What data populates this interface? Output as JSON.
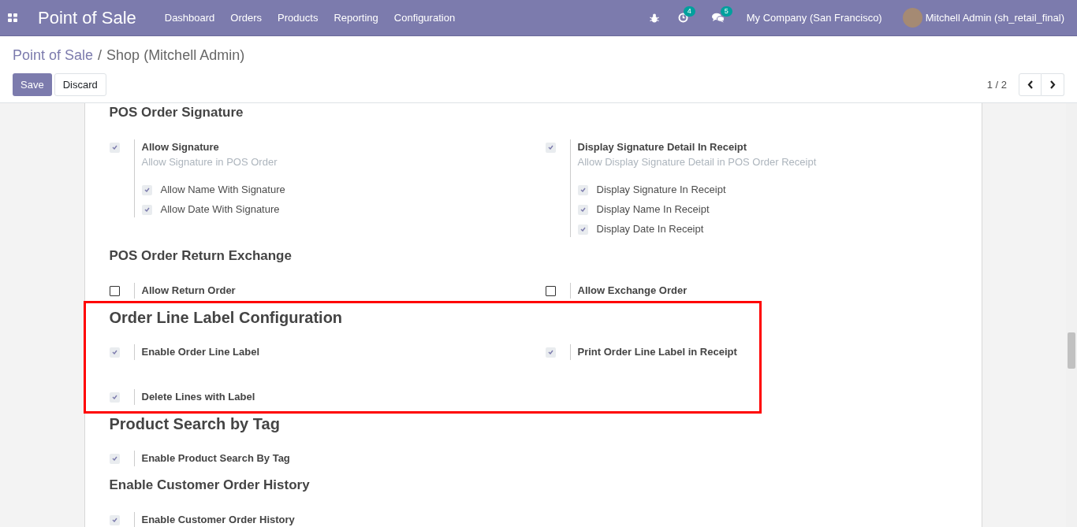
{
  "navbar": {
    "app_title": "Point of Sale",
    "menu": [
      "Dashboard",
      "Orders",
      "Products",
      "Reporting",
      "Configuration"
    ],
    "activity_count": "4",
    "message_count": "5",
    "company": "My Company (San Francisco)",
    "user": "Mitchell Admin (sh_retail_final)"
  },
  "breadcrumb": {
    "parent": "Point of Sale",
    "separator": "/",
    "current": "Shop (Mitchell Admin)"
  },
  "buttons": {
    "save": "Save",
    "discard": "Discard"
  },
  "pager": "1 / 2",
  "sections": [
    {
      "title": "POS Order Signature",
      "kind": "minor",
      "highlighted": false,
      "settings": [
        {
          "label": "Allow Signature",
          "description": "Allow Signature in POS Order",
          "checked": true,
          "children": [
            {
              "label": "Allow Name With Signature",
              "checked": true
            },
            {
              "label": "Allow Date With Signature",
              "checked": true
            }
          ]
        },
        {
          "label": "Display Signature Detail In Receipt",
          "description": "Allow Display Signature Detail in POS Order Receipt",
          "checked": true,
          "children": [
            {
              "label": "Display Signature In Receipt",
              "checked": true
            },
            {
              "label": "Display Name In Receipt",
              "checked": true
            },
            {
              "label": "Display Date In Receipt",
              "checked": true
            }
          ]
        }
      ]
    },
    {
      "title": "POS Order Return Exchange",
      "kind": "minor",
      "highlighted": false,
      "settings": [
        {
          "label": "Allow Return Order",
          "checked": false
        },
        {
          "label": "Allow Exchange Order",
          "checked": false
        }
      ]
    },
    {
      "title": "Order Line Label Configuration",
      "kind": "major",
      "highlighted": true,
      "settings": [
        {
          "label": "Enable Order Line Label",
          "checked": true
        },
        {
          "label": "Print Order Line Label in Receipt",
          "checked": true
        },
        {
          "label": "Delete Lines with Label",
          "checked": true
        }
      ]
    },
    {
      "title": "Product Search by Tag",
      "kind": "major",
      "highlighted": false,
      "settings": [
        {
          "label": "Enable Product Search By Tag",
          "checked": true
        }
      ]
    },
    {
      "title": "Enable Customer Order History",
      "kind": "minor",
      "highlighted": false,
      "settings": [
        {
          "label": "Enable Customer Order History",
          "checked": true
        }
      ]
    }
  ]
}
